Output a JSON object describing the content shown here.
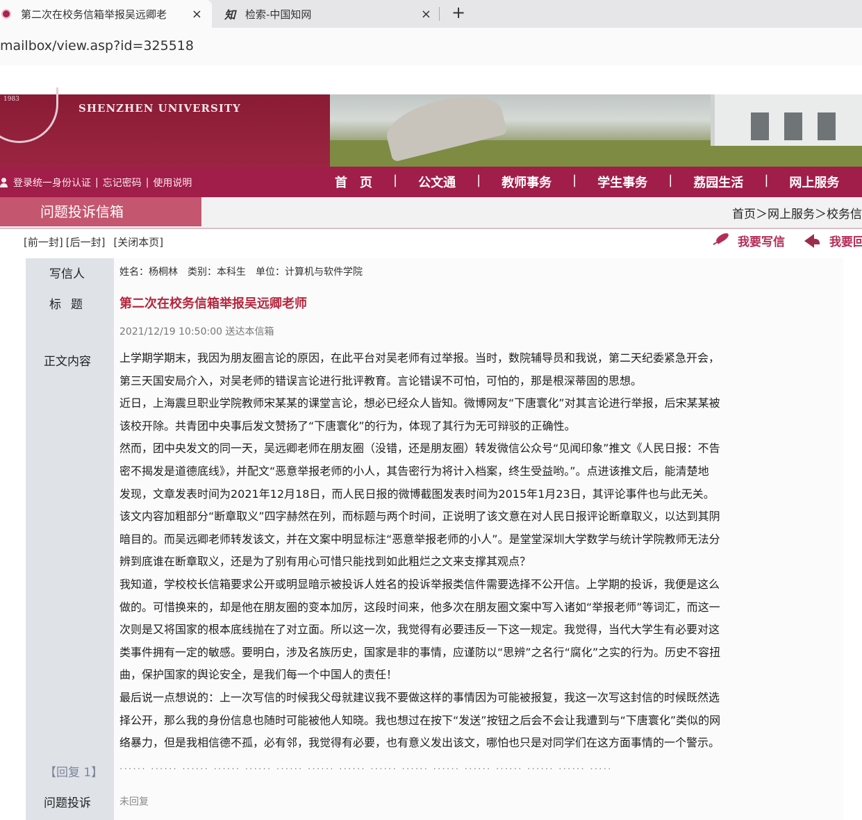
{
  "browser": {
    "tabs": [
      {
        "title": "第二次在校务信箱举报吴远卿老",
        "close": "×"
      },
      {
        "title": "检索-中国知网",
        "icon_text": "知",
        "close": "×"
      }
    ],
    "new_tab": "+",
    "url": "mailbox/view.asp?id=325518"
  },
  "site": {
    "logo_year": "1983",
    "name_en": "SHENZHEN UNIVERSITY",
    "login_links": [
      "登录统一身份认证",
      "忘记密码",
      "使用说明"
    ],
    "nav": [
      "首　页",
      "公文通",
      "教师事务",
      "学生事务",
      "荔园生活",
      "网上服务"
    ],
    "nav_sep": "|",
    "link_sep": "|"
  },
  "section": {
    "title": "问题投诉信箱",
    "breadcrumb": "首页＞网上服务＞校务信"
  },
  "toolbar": {
    "prev": "[前一封]",
    "next": "[后一封]",
    "close": "[关闭本页]",
    "write": "我要写信",
    "reply": "我要回"
  },
  "letter": {
    "labels": {
      "sender": "写信人",
      "subject": "标题",
      "body": "正文内容",
      "reply": "【回复 1】",
      "complaint": "问题投诉"
    },
    "sender": {
      "name": "姓名：杨桐林",
      "category": "类别：本科生",
      "unit": "单位：计算机与软件学院"
    },
    "subject": "第二次在校务信箱举报吴远卿老师",
    "date": "2021/12/19 10:50:00 送达本信箱",
    "body_lines": [
      "上学期学期末，我因为朋友圈言论的原因，在此平台对吴老师有过举报。当时，数院辅导员和我说，第二天纪委紧急开会，",
      "第三天国安局介入，对吴老师的错误言论进行批评教育。言论错误不可怕，可怕的，那是根深蒂固的思想。",
      "近日，上海震旦职业学院教师宋某某的课堂言论，想必已经众人皆知。微博网友“下唐寰化”对其言论进行举报，后宋某某被",
      "该校开除。共青团中央事后发文赞扬了“下唐寰化”的行为，体现了其行为无可辩驳的正确性。",
      "然而，团中央发文的同一天，吴远卿老师在朋友圈（没错，还是朋友圈）转发微信公众号“见闻印象”推文《人民日报：不告",
      "密不揭发是道德底线》，并配文“恶意举报老师的小人，其告密行为将计入档案，终生受益哟。”。点进该推文后，能清楚地",
      "发现，文章发表时间为2021年12月18日，而人民日报的微博截图发表时间为2015年1月23日，其评论事件也与此无关。",
      "该文内容加粗部分“断章取义”四字赫然在列，而标题与两个时间，正说明了该文意在对人民日报评论断章取义，以达到其阴",
      "暗目的。而吴远卿老师转发该文，并在文案中明显标注“恶意举报老师的小人”。是堂堂深圳大学数学与统计学院教师无法分",
      "辨到底谁在断章取义，还是为了别有用心可惜只能找到如此粗烂之文来支撑其观点？",
      "我知道，学校校长信箱要求公开或明显暗示被投诉人姓名的投诉举报类信件需要选择不公开信。上学期的投诉，我便是这么",
      "做的。可惜换来的，却是他在朋友圈的变本加厉，这段时间来，他多次在朋友圈文案中写入诸如“举报老师”等词汇，而这一",
      "次则是又将国家的根本底线抛在了对立面。所以这一次，我觉得有必要违反一下这一规定。我觉得，当代大学生有必要对这",
      "类事件拥有一定的敏感。要明白，涉及名族历史，国家是非的事情，应谨防以“思辨”之名行“腐化”之实的行为。历史不容扭",
      "曲，保护国家的舆论安全，是我们每一个中国人的责任！",
      "最后说一点想说的：上一次写信的时候我父母就建议我不要做这样的事情因为可能被报复，我这一次写这封信的时候既然选",
      "择公开，那么我的身份信息也随时可能被他人知晓。我也想过在按下“发送”按钮之后会不会让我遭到与“下唐寰化”类似的网",
      "络暴力，但是我相信德不孤，必有邻，我觉得有必要，也有意义发出该文，哪怕也只是对同学们在这方面事情的一个警示。"
    ],
    "reply_status": "未回复"
  },
  "colors": {
    "banner": "#8a1b35",
    "navbar": "#a11d4a",
    "section_tab": "#c4566f",
    "subject": "#b5263d",
    "link": "#b62b57"
  }
}
